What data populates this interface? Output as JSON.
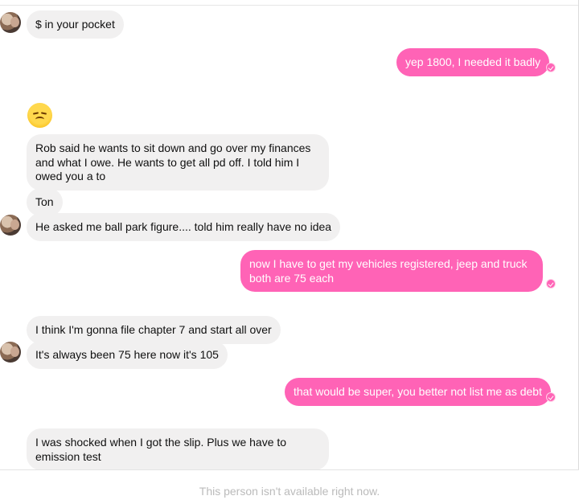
{
  "conversation": {
    "messages": [
      {
        "from": "them",
        "text": "$ in your pocket"
      },
      {
        "from": "me",
        "text": "yep 1800, I needed it badly"
      },
      {
        "from": "them",
        "text": "😞"
      },
      {
        "from": "them",
        "text": "Rob said he wants to sit down and go over my finances and what I owe. He wants to get all pd off. I told him I owed you a to"
      },
      {
        "from": "them",
        "text": "Ton"
      },
      {
        "from": "them",
        "text": "He asked me ball park figure.... told him really have no idea"
      },
      {
        "from": "me",
        "text": "now I have to get my vehicles registered, jeep and truck both are 75 each"
      },
      {
        "from": "them",
        "text": "I think I'm gonna file chapter 7 and start all over"
      },
      {
        "from": "them",
        "text": "It's always been 75 here now it's 105"
      },
      {
        "from": "me",
        "text": "that would be super, you better not list me as debt"
      },
      {
        "from": "them",
        "text": "I was shocked when I got the slip. Plus we have to emission test"
      }
    ]
  },
  "footer": {
    "status_text": "This person isn't available right now."
  },
  "colors": {
    "outgoing_bubble": "#ff63b6",
    "incoming_bubble": "#f1f0f0"
  },
  "icons": {
    "avatar": "contact-avatar-icon",
    "seen": "seen-receipt-icon"
  }
}
